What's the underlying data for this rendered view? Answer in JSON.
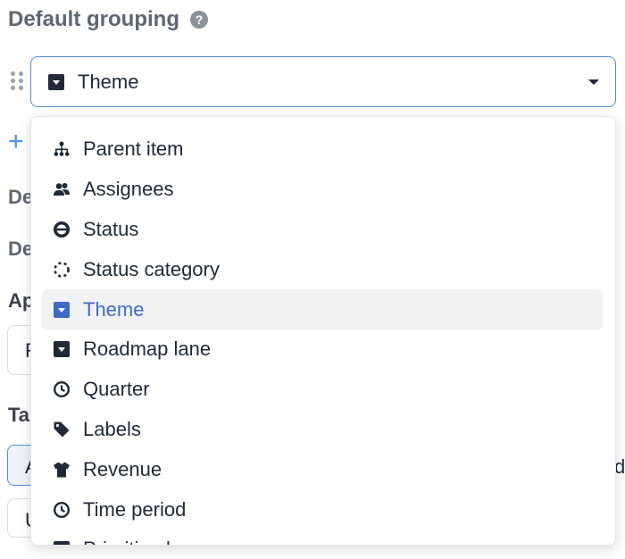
{
  "section": {
    "title": "Default grouping",
    "help_glyph": "?"
  },
  "select": {
    "value": "Theme",
    "icon": "square-caret-down-icon"
  },
  "background_fragments": {
    "line1": "De",
    "line2": "De",
    "line3": "Ap",
    "line4": "Ta",
    "box1_text": "R",
    "box2_text": "A",
    "box3_text": "U",
    "right_text": "d"
  },
  "dropdown": {
    "items": [
      {
        "label": "Parent item",
        "icon": "hierarchy-icon"
      },
      {
        "label": "Assignees",
        "icon": "users-icon"
      },
      {
        "label": "Status",
        "icon": "status-circle-icon"
      },
      {
        "label": "Status category",
        "icon": "dashed-circle-icon"
      },
      {
        "label": "Theme",
        "icon": "square-caret-down-icon",
        "selected": true
      },
      {
        "label": "Roadmap lane",
        "icon": "square-caret-down-icon"
      },
      {
        "label": "Quarter",
        "icon": "clock-icon"
      },
      {
        "label": "Labels",
        "icon": "tag-icon"
      },
      {
        "label": "Revenue",
        "icon": "shirt-icon"
      },
      {
        "label": "Time period",
        "icon": "clock-icon"
      },
      {
        "label": "Prioritized",
        "icon": "square-caret-down-icon"
      }
    ]
  },
  "colors": {
    "accent": "#4a8ee0",
    "selected_text": "#3d6bc4",
    "selected_bg": "#f1f2f4",
    "selected_icon": "#3d6bc4"
  }
}
